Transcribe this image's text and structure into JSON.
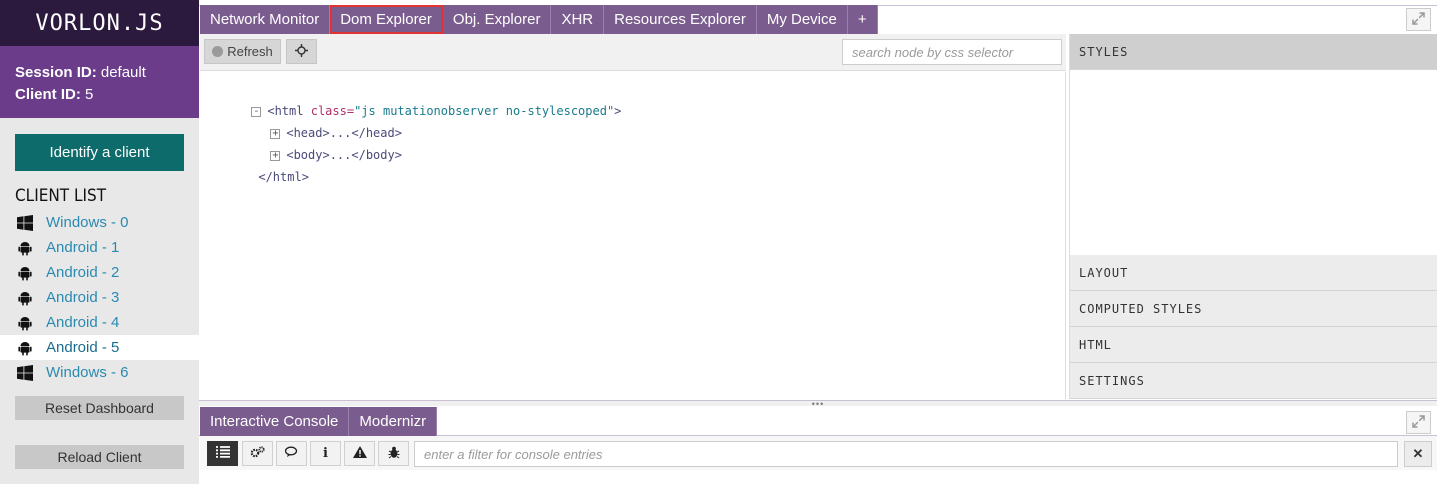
{
  "sidebar": {
    "logo": "VORLON.JS",
    "session_label": "Session ID:",
    "session_value": "default",
    "client_label": "Client ID:",
    "client_value": "5",
    "identify_button": "Identify a client",
    "client_list_title": "CLIENT LIST",
    "clients": [
      {
        "label": "Windows - 0",
        "icon": "windows-icon"
      },
      {
        "label": "Android - 1",
        "icon": "android-icon"
      },
      {
        "label": "Android - 2",
        "icon": "android-icon"
      },
      {
        "label": "Android - 3",
        "icon": "android-icon"
      },
      {
        "label": "Android - 4",
        "icon": "android-icon"
      },
      {
        "label": "Android - 5",
        "icon": "android-icon",
        "active": true
      },
      {
        "label": "Windows - 6",
        "icon": "windows-icon"
      }
    ],
    "reset_button": "Reset Dashboard",
    "reload_button": "Reload Client"
  },
  "tabs": [
    {
      "label": "Network Monitor"
    },
    {
      "label": "Dom Explorer",
      "active": true
    },
    {
      "label": "Obj. Explorer"
    },
    {
      "label": "XHR"
    },
    {
      "label": "Resources Explorer"
    },
    {
      "label": "My Device"
    },
    {
      "label": "+"
    }
  ],
  "dom_explorer": {
    "refresh_label": "Refresh",
    "search_placeholder": "search node by css selector",
    "tree": {
      "html_tag_open": "<html",
      "html_attr": "class=",
      "html_attr_value": "\"js mutationobserver no-stylescoped\"",
      "html_tag_close": ">",
      "head": "<head>...</head>",
      "body": "<body>...</body>",
      "html_end": "</html>",
      "collapse": "-",
      "expand": "+"
    }
  },
  "style_panels": {
    "styles": "STYLES",
    "layout": "LAYOUT",
    "computed": "COMPUTED STYLES",
    "html": "HTML",
    "settings": "SETTINGS"
  },
  "bottom_tabs": [
    {
      "label": "Interactive Console"
    },
    {
      "label": "Modernizr"
    }
  ],
  "console": {
    "filter_placeholder": "enter a filter for console entries",
    "clear_label": "✕",
    "info_label": "i"
  },
  "colors": {
    "accent_purple": "#7b5c8e",
    "session_purple": "#6a3c8a",
    "logo_dark": "#2b1a3d",
    "teal_button": "#0d6b6b",
    "active_tab_outline": "#e03333"
  }
}
